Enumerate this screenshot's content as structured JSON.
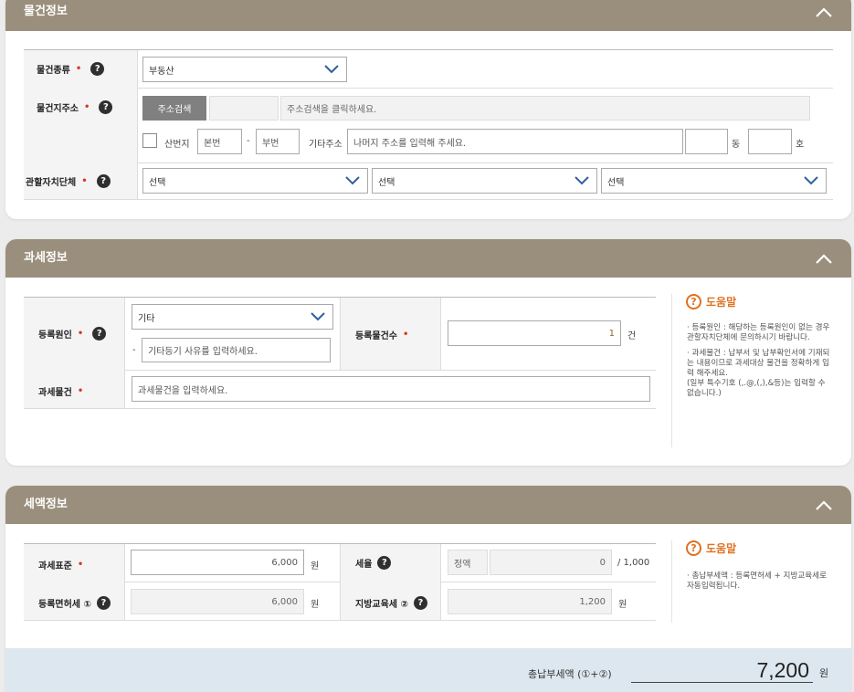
{
  "property": {
    "title": "물건정보",
    "type_label": "물건종류",
    "type_value": "부동산",
    "address_label": "물건지주소",
    "search_button": "주소검색",
    "address_placeholder": "주소검색을 클릭하세요.",
    "mountain_label": "산번지",
    "main_no_placeholder": "본번",
    "dash": "-",
    "sub_no_placeholder": "부번",
    "other_addr_label": "기타주소",
    "other_addr_placeholder": "나머지 주소를 입력해 주세요.",
    "dong_suffix": "동",
    "ho_suffix": "호",
    "local_gov_label": "관할자치단체",
    "select1": "선택",
    "select2": "선택",
    "select3": "선택"
  },
  "tax": {
    "title": "과세정보",
    "reason_label": "등록원인",
    "reason_value": "기타",
    "reason_dash": "-",
    "reason_placeholder": "기타등기 사유를 입력하세요.",
    "count_label": "등록물건수",
    "count_value": "1",
    "count_unit": "건",
    "object_label": "과세물건",
    "object_placeholder": "과세물건을 입력하세요.",
    "help_title": "도움말",
    "help_1": "· 등록원인 : 해당하는 등록원인이 없는 경우 관할자치단체에 문의하시기 바랍니다.",
    "help_2": "· 과세물건 : 납부서 및 납부확인서에 기재되는 내용이므로 과세대상 물건을 정확하게 입력 해주세요.",
    "help_3": "(일부 특수기호 (,.@,(,),&등)는 입력할 수 없습니다.)"
  },
  "amount": {
    "title": "세액정보",
    "base_label": "과세표준",
    "base_value": "6,000",
    "won": "원",
    "rate_label": "세율",
    "rate_type": "정액",
    "rate_value": "0",
    "rate_denominator": "/ 1,000",
    "reg_tax_label": "등록면허세 ①",
    "reg_tax_value": "6,000",
    "edu_tax_label": "지방교육세 ②",
    "edu_tax_value": "1,200",
    "help_title": "도움말",
    "help_1": "· 총납부세액 : 등록면허세 + 지방교육세로 자동입력됩니다.",
    "total_label": "총납부세액 (①+②)",
    "total_value": "7,200",
    "total_unit": "원"
  },
  "colors": {
    "header": "#9a8f7c",
    "required": "#d83a1e",
    "help": "#e07020",
    "total_bg": "#dde7ef"
  }
}
